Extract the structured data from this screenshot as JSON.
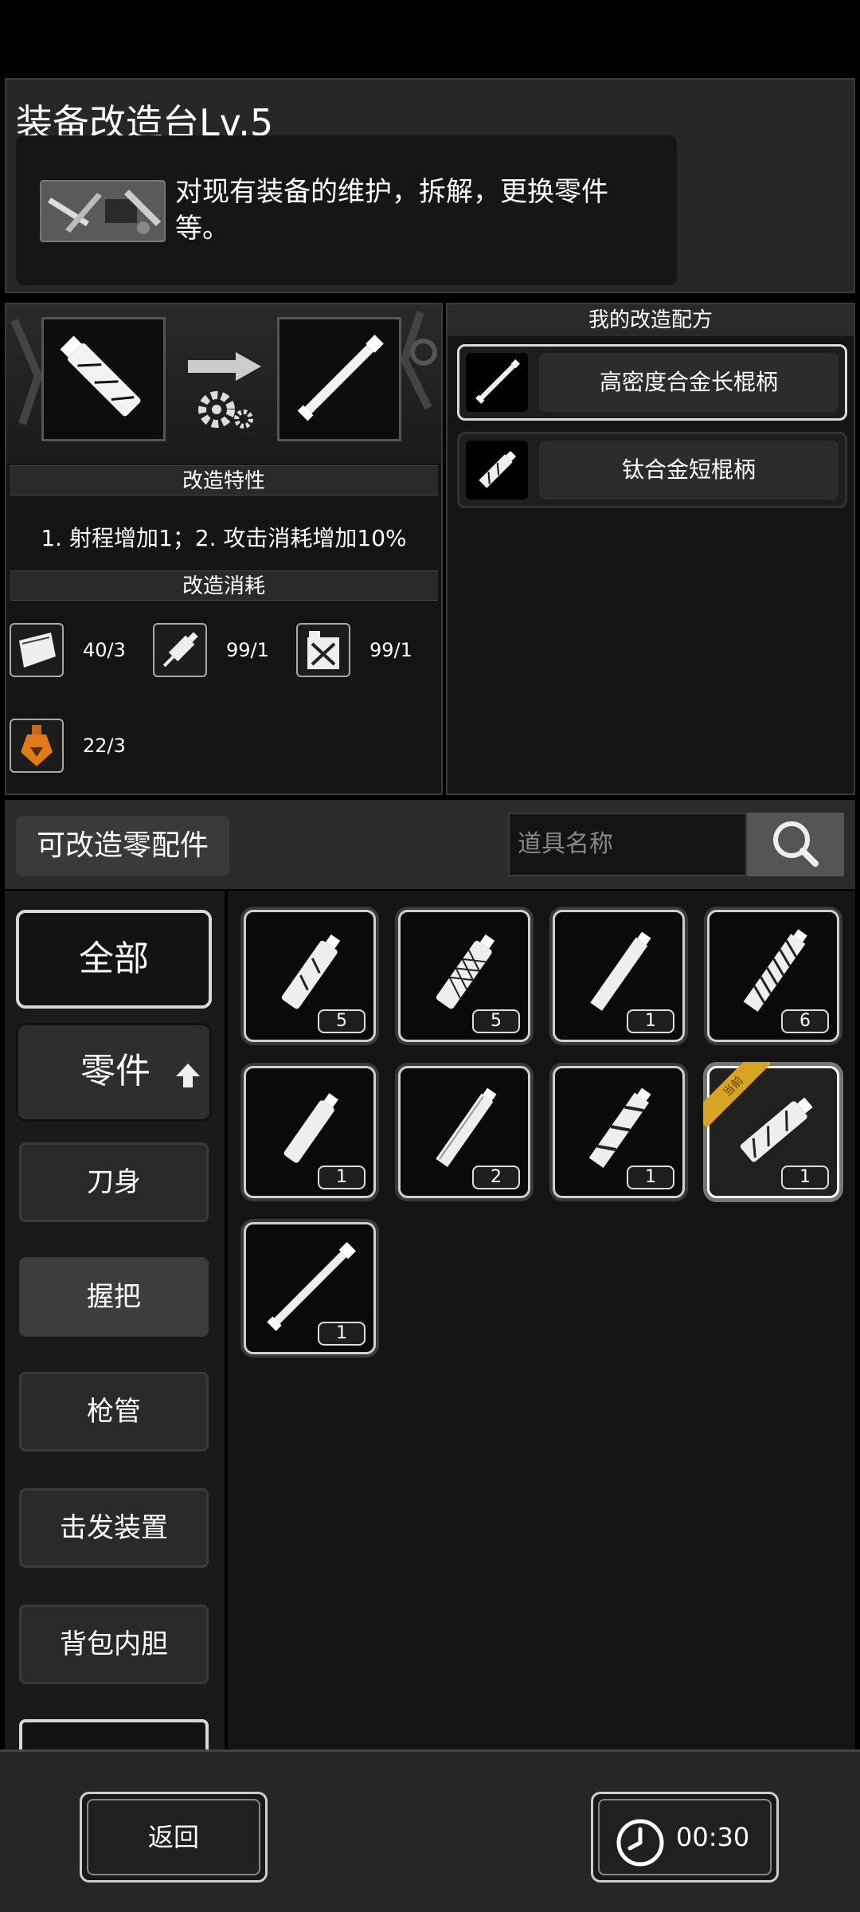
{
  "header": {
    "title": "装备改造台Lv.5",
    "description": "对现有装备的维护，拆解，更换零件等。",
    "icon": "workbench-tools-icon"
  },
  "mod": {
    "arrow_icon": "arrow-right-gear-icon",
    "traits_title": "改造特性",
    "traits_text": "1. 射程增加1；2. 攻击消耗增加10%",
    "cost_title": "改造消耗",
    "costs": [
      {
        "icon": "cloth-icon",
        "value": "40/3"
      },
      {
        "icon": "syringe-icon",
        "value": "99/1"
      },
      {
        "icon": "fuel-can-icon",
        "value": "99/1"
      },
      {
        "icon": "potion-bottle-icon",
        "value": "22/3"
      }
    ]
  },
  "recipes": {
    "title": "我的改造配方",
    "items": [
      {
        "name": "高密度合金长棍柄",
        "selected": true
      },
      {
        "name": "钛合金短棍柄",
        "selected": false
      }
    ]
  },
  "parts": {
    "label": "可改造零配件",
    "search_placeholder": "道具名称",
    "categories": [
      "全部",
      "零件",
      "刀身",
      "握把",
      "枪管",
      "击发装置",
      "背包内胆"
    ],
    "items": [
      {
        "count": "5",
        "current": false
      },
      {
        "count": "5",
        "current": false
      },
      {
        "count": "1",
        "current": false
      },
      {
        "count": "6",
        "current": false
      },
      {
        "count": "1",
        "current": false
      },
      {
        "count": "2",
        "current": false
      },
      {
        "count": "1",
        "current": false
      },
      {
        "count": "1",
        "current": true
      },
      {
        "count": "1",
        "current": false
      }
    ],
    "current_badge": "当前"
  },
  "footer": {
    "back_label": "返回",
    "timer": "00:30"
  },
  "colors": {
    "background": "#000000",
    "panel": "#141414",
    "badge": "#d9a422"
  }
}
